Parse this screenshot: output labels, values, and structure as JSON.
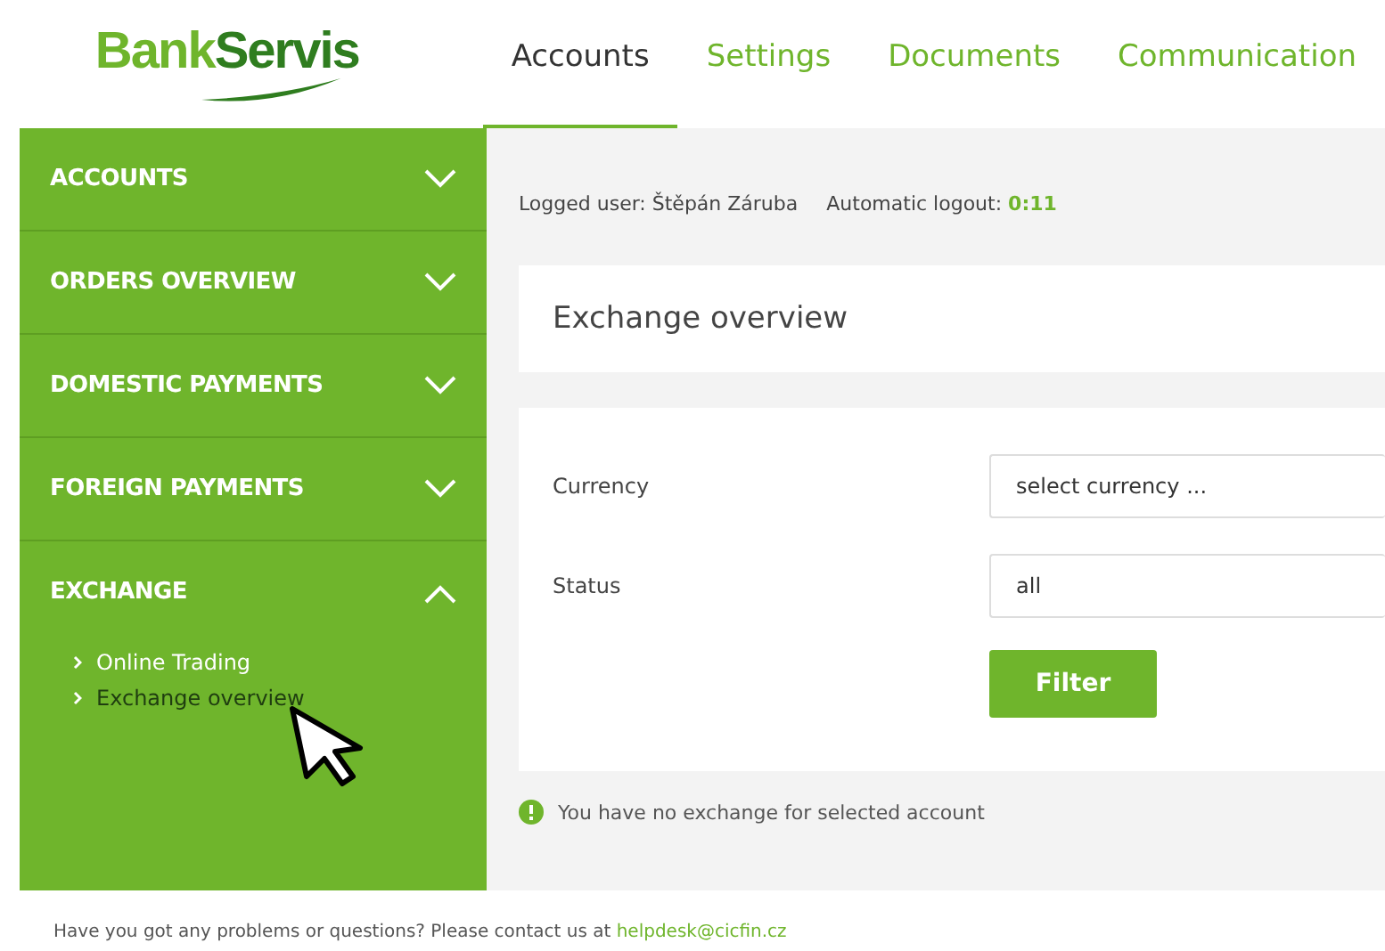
{
  "logo": {
    "text_1": "Bank",
    "text_2": "Servis"
  },
  "tabs": [
    {
      "label": "Accounts",
      "selected": true
    },
    {
      "label": "Settings",
      "selected": false
    },
    {
      "label": "Documents",
      "selected": false
    },
    {
      "label": "Communication",
      "selected": false
    }
  ],
  "sidebar": {
    "items": [
      {
        "label": "ACCOUNTS",
        "expanded": false
      },
      {
        "label": "ORDERS OVERVIEW",
        "expanded": false
      },
      {
        "label": "DOMESTIC PAYMENTS",
        "expanded": false
      },
      {
        "label": "FOREIGN PAYMENTS",
        "expanded": false
      },
      {
        "label": "EXCHANGE",
        "expanded": true,
        "children": [
          {
            "label": "Online Trading",
            "selected": false
          },
          {
            "label": "Exchange overview",
            "selected": true
          }
        ]
      }
    ]
  },
  "session": {
    "user_label": "Logged user: Štěpán Záruba",
    "logout_label": "Automatic logout:",
    "logout_time": "0:11"
  },
  "page_title": "Exchange overview",
  "form": {
    "fields": [
      {
        "label": "Currency",
        "placeholder": "select currency ..."
      },
      {
        "label": "Status",
        "value": "all"
      }
    ],
    "button": "Filter"
  },
  "notice": "You have no exchange for selected account",
  "footer": {
    "text": "Have you got any problems or questions? Please contact us at",
    "link": "helpdesk@cicfin.cz"
  }
}
